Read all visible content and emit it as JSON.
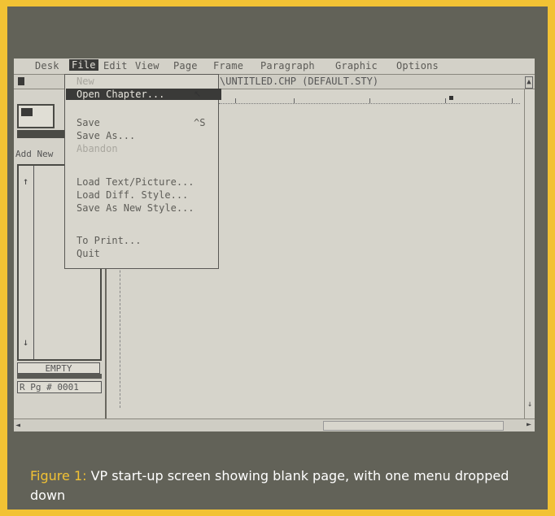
{
  "menubar": {
    "items": [
      "Desk",
      "File",
      "Edit",
      "View",
      "Page",
      "Frame",
      "Paragraph",
      "Graphic",
      "Options"
    ],
    "active": "File"
  },
  "window": {
    "title": "\\UNTITLED.CHP  (DEFAULT.STY)"
  },
  "sidebar": {
    "add_new_label": "Add New",
    "status_label": "EMPTY",
    "page_indicator": "R Pg # 0001"
  },
  "file_menu": {
    "new": "New",
    "open_chapter": "Open Chapter...",
    "save": "Save",
    "save_shortcut": "^S",
    "save_as": "Save As...",
    "abandon": "Abandon",
    "load_text_picture": "Load Text/Picture...",
    "load_diff_style": "Load Diff. Style...",
    "save_as_new_style": "Save As New Style...",
    "to_print": "To Print...",
    "quit": "Quit"
  },
  "caption": {
    "label": "Figure 1:",
    "text": " VP start-up screen showing blank page, with one menu  dropped down"
  },
  "colors": {
    "border": "#f2c234",
    "photo_background": "#626258",
    "screen": "#d6d4cb",
    "highlight": "#3a3a38"
  }
}
